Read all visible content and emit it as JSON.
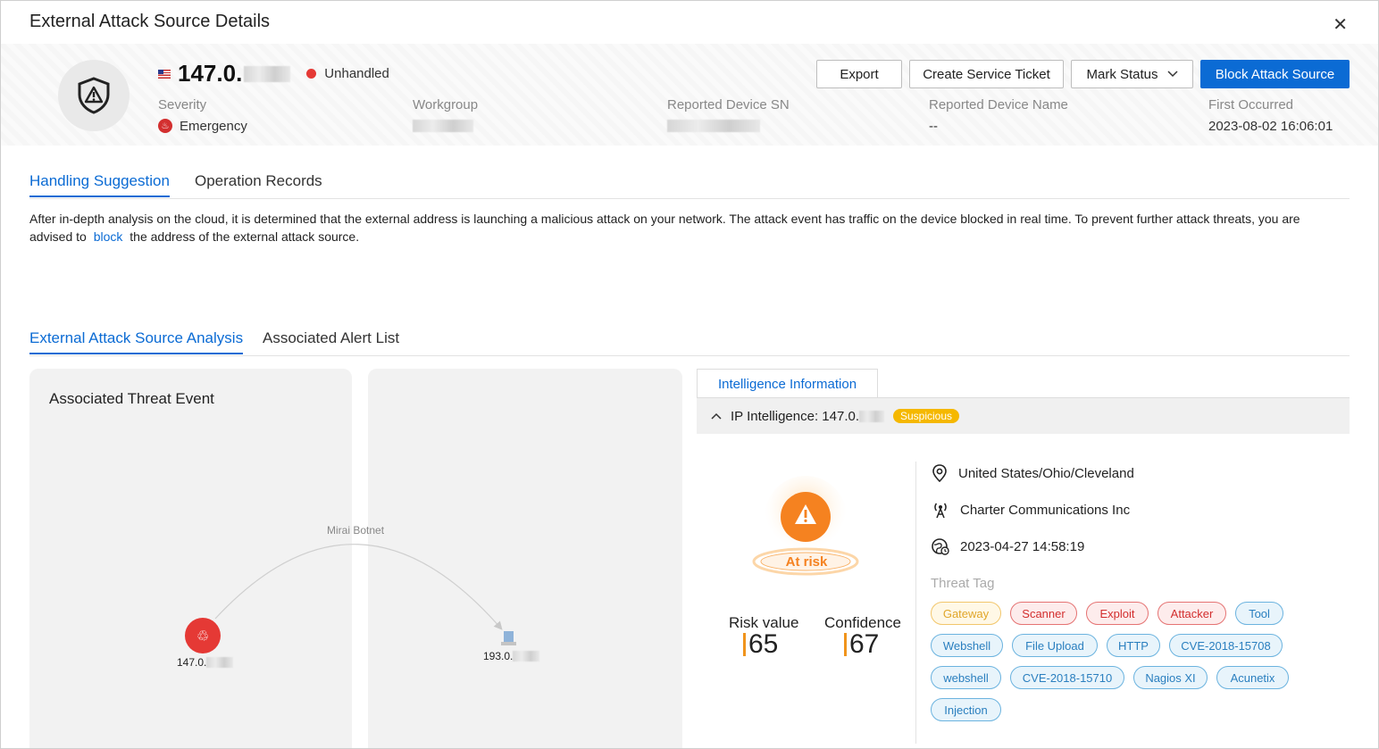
{
  "dialog": {
    "title": "External Attack Source Details",
    "close_icon": "close-icon"
  },
  "source": {
    "ip_prefix": "147.0.",
    "status": "Unhandled",
    "status_color": "#e53935",
    "severity_label": "Severity",
    "severity_value": "Emergency",
    "workgroup_label": "Workgroup",
    "device_sn_label": "Reported Device SN",
    "device_name_label": "Reported Device Name",
    "device_name_value": "--",
    "first_occurred_label": "First Occurred",
    "first_occurred_value": "2023-08-02 16:06:01"
  },
  "actions": {
    "export": "Export",
    "create_ticket": "Create Service Ticket",
    "mark_status": "Mark Status",
    "block": "Block Attack Source",
    "accent": "#0b6bd4"
  },
  "tabs_top": [
    {
      "label": "Handling Suggestion",
      "active": true
    },
    {
      "label": "Operation Records",
      "active": false
    }
  ],
  "suggestion": {
    "before": "After in-depth analysis on the cloud, it is determined that the external address is launching a malicious attack on your network. The attack event has traffic on the device blocked in real time. To prevent further attack threats, you are advised to",
    "link": "block",
    "after": "the address of the external attack source."
  },
  "tabs_analysis": [
    {
      "label": "External Attack Source Analysis",
      "active": true
    },
    {
      "label": "Associated Alert List",
      "active": false
    }
  ],
  "graph": {
    "title": "Associated Threat Event",
    "edge_label": "Mirai Botnet",
    "source_node": "147.0.",
    "target_node": "193.0."
  },
  "intel": {
    "tab": "Intelligence Information",
    "ip_label": "IP Intelligence: 147.0.",
    "verdict": "Suspicious",
    "risk_status": "At risk",
    "risk_value_label": "Risk value",
    "risk_value": "65",
    "confidence_label": "Confidence",
    "confidence": "67",
    "location": "United States/Ohio/Cleveland",
    "isp": "Charter Communications Inc",
    "time": "2023-04-27 14:58:19",
    "threat_tag_label": "Threat Tag",
    "tags": [
      "Gateway",
      "Scanner",
      "Exploit",
      "Attacker",
      "Tool",
      "Webshell",
      "File Upload",
      "HTTP",
      "CVE-2018-15708",
      "webshell",
      "CVE-2018-15710",
      "Nagios XI",
      "Acunetix",
      "Injection"
    ]
  }
}
